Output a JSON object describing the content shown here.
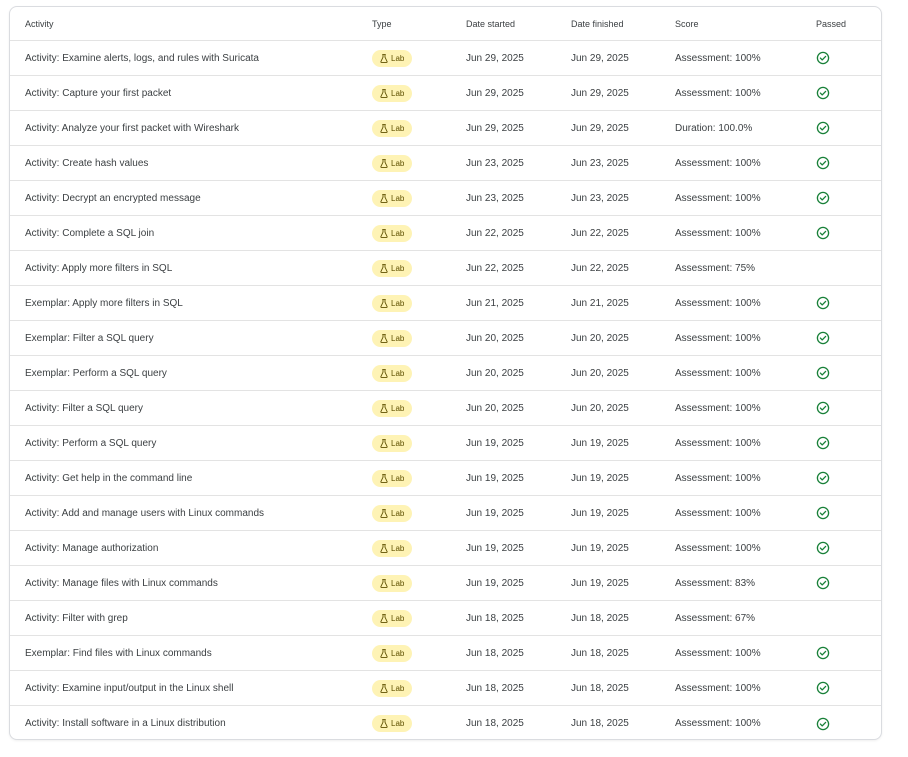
{
  "table": {
    "headers": {
      "activity": "Activity",
      "type": "Type",
      "date_started": "Date started",
      "date_finished": "Date finished",
      "score": "Score",
      "passed": "Passed"
    },
    "accent_colors": {
      "badge_bg": "#fef3b5",
      "passed_check": "#188038"
    },
    "rows": [
      {
        "activity": "Activity: Examine alerts, logs, and rules with Suricata",
        "type": "Lab",
        "type_icon": "flask-icon",
        "date_started": "Jun 29, 2025",
        "date_finished": "Jun 29, 2025",
        "score": "Assessment: 100%",
        "passed": true
      },
      {
        "activity": "Activity: Capture your first packet",
        "type": "Lab",
        "type_icon": "flask-icon",
        "date_started": "Jun 29, 2025",
        "date_finished": "Jun 29, 2025",
        "score": "Assessment: 100%",
        "passed": true
      },
      {
        "activity": "Activity: Analyze your first packet with Wireshark",
        "type": "Lab",
        "type_icon": "flask-icon",
        "date_started": "Jun 29, 2025",
        "date_finished": "Jun 29, 2025",
        "score": "Duration: 100.0%",
        "passed": true
      },
      {
        "activity": "Activity: Create hash values",
        "type": "Lab",
        "type_icon": "flask-icon",
        "date_started": "Jun 23, 2025",
        "date_finished": "Jun 23, 2025",
        "score": "Assessment: 100%",
        "passed": true
      },
      {
        "activity": "Activity: Decrypt an encrypted message",
        "type": "Lab",
        "type_icon": "flask-icon",
        "date_started": "Jun 23, 2025",
        "date_finished": "Jun 23, 2025",
        "score": "Assessment: 100%",
        "passed": true
      },
      {
        "activity": "Activity: Complete a SQL join",
        "type": "Lab",
        "type_icon": "flask-icon",
        "date_started": "Jun 22, 2025",
        "date_finished": "Jun 22, 2025",
        "score": "Assessment: 100%",
        "passed": true
      },
      {
        "activity": "Activity: Apply more filters in SQL",
        "type": "Lab",
        "type_icon": "flask-icon",
        "date_started": "Jun 22, 2025",
        "date_finished": "Jun 22, 2025",
        "score": "Assessment: 75%",
        "passed": false
      },
      {
        "activity": "Exemplar: Apply more filters in SQL",
        "type": "Lab",
        "type_icon": "flask-icon",
        "date_started": "Jun 21, 2025",
        "date_finished": "Jun 21, 2025",
        "score": "Assessment: 100%",
        "passed": true
      },
      {
        "activity": "Exemplar: Filter a SQL query",
        "type": "Lab",
        "type_icon": "flask-icon",
        "date_started": "Jun 20, 2025",
        "date_finished": "Jun 20, 2025",
        "score": "Assessment: 100%",
        "passed": true
      },
      {
        "activity": "Exemplar: Perform a SQL query",
        "type": "Lab",
        "type_icon": "flask-icon",
        "date_started": "Jun 20, 2025",
        "date_finished": "Jun 20, 2025",
        "score": "Assessment: 100%",
        "passed": true
      },
      {
        "activity": "Activity: Filter a SQL query",
        "type": "Lab",
        "type_icon": "flask-icon",
        "date_started": "Jun 20, 2025",
        "date_finished": "Jun 20, 2025",
        "score": "Assessment: 100%",
        "passed": true
      },
      {
        "activity": "Activity: Perform a SQL query",
        "type": "Lab",
        "type_icon": "flask-icon",
        "date_started": "Jun 19, 2025",
        "date_finished": "Jun 19, 2025",
        "score": "Assessment: 100%",
        "passed": true
      },
      {
        "activity": "Activity: Get help in the command line",
        "type": "Lab",
        "type_icon": "flask-icon",
        "date_started": "Jun 19, 2025",
        "date_finished": "Jun 19, 2025",
        "score": "Assessment: 100%",
        "passed": true
      },
      {
        "activity": "Activity: Add and manage users with Linux commands",
        "type": "Lab",
        "type_icon": "flask-icon",
        "date_started": "Jun 19, 2025",
        "date_finished": "Jun 19, 2025",
        "score": "Assessment: 100%",
        "passed": true
      },
      {
        "activity": "Activity: Manage authorization",
        "type": "Lab",
        "type_icon": "flask-icon",
        "date_started": "Jun 19, 2025",
        "date_finished": "Jun 19, 2025",
        "score": "Assessment: 100%",
        "passed": true
      },
      {
        "activity": "Activity: Manage files with Linux commands",
        "type": "Lab",
        "type_icon": "flask-icon",
        "date_started": "Jun 19, 2025",
        "date_finished": "Jun 19, 2025",
        "score": "Assessment: 83%",
        "passed": true
      },
      {
        "activity": "Activity: Filter with grep",
        "type": "Lab",
        "type_icon": "flask-icon",
        "date_started": "Jun 18, 2025",
        "date_finished": "Jun 18, 2025",
        "score": "Assessment: 67%",
        "passed": false
      },
      {
        "activity": "Exemplar: Find files with Linux commands",
        "type": "Lab",
        "type_icon": "flask-icon",
        "date_started": "Jun 18, 2025",
        "date_finished": "Jun 18, 2025",
        "score": "Assessment: 100%",
        "passed": true
      },
      {
        "activity": "Activity: Examine input/output in the Linux shell",
        "type": "Lab",
        "type_icon": "flask-icon",
        "date_started": "Jun 18, 2025",
        "date_finished": "Jun 18, 2025",
        "score": "Assessment: 100%",
        "passed": true
      },
      {
        "activity": "Activity: Install software in a Linux distribution",
        "type": "Lab",
        "type_icon": "flask-icon",
        "date_started": "Jun 18, 2025",
        "date_finished": "Jun 18, 2025",
        "score": "Assessment: 100%",
        "passed": true
      }
    ]
  }
}
